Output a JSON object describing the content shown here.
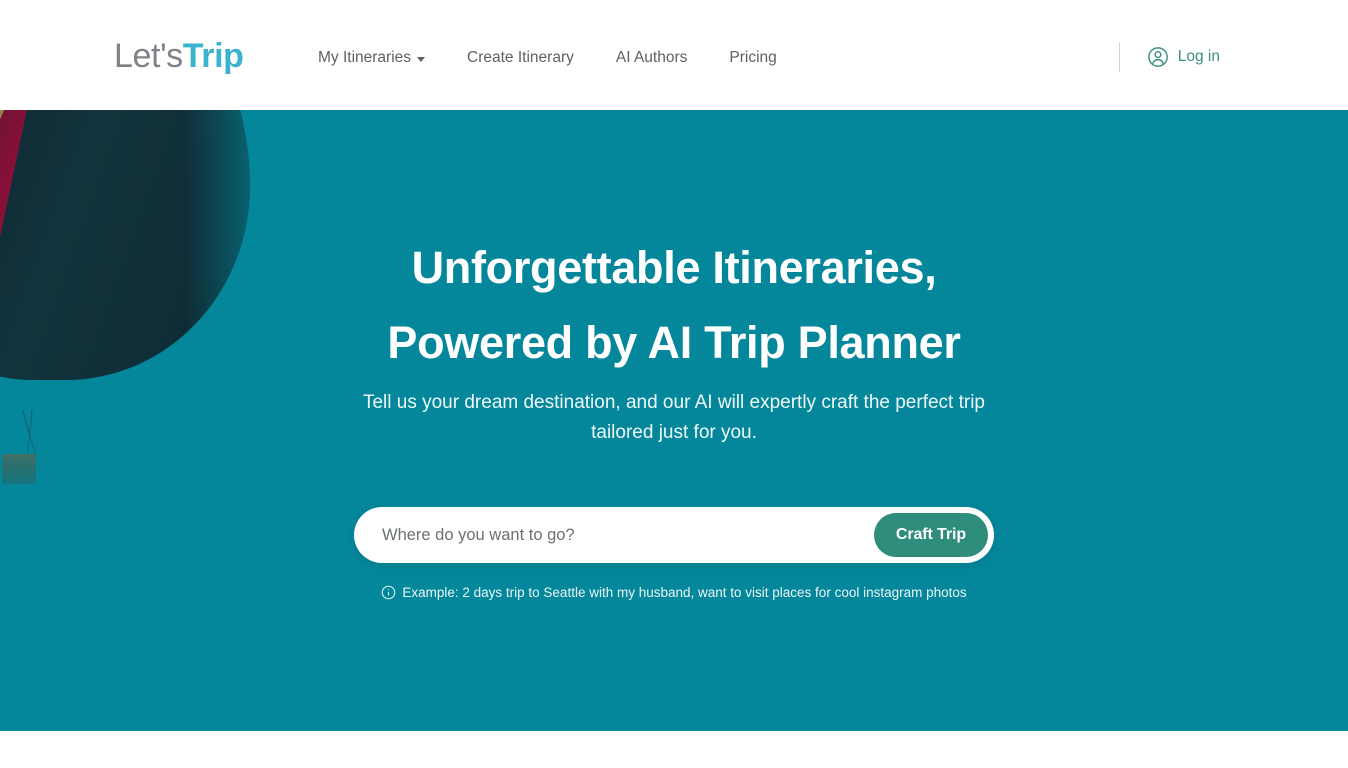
{
  "header": {
    "brand": {
      "part1": "Let's",
      "part2": "Trip"
    },
    "nav": [
      {
        "label": "My Itineraries",
        "has_dropdown": true,
        "icon": "chevron-down-icon"
      },
      {
        "label": "Create Itinerary",
        "has_dropdown": false
      },
      {
        "label": "AI Authors",
        "has_dropdown": false
      },
      {
        "label": "Pricing",
        "has_dropdown": false
      }
    ],
    "login": {
      "label": "Log in",
      "icon": "user-circle-icon"
    }
  },
  "hero": {
    "title_line1": "Unforgettable Itineraries,",
    "title_line2": "Powered by AI Trip Planner",
    "subtitle": "Tell us your dream destination, and our AI will expertly craft the perfect trip tailored just for you.",
    "search": {
      "placeholder": "Where do you want to go?",
      "value": "",
      "button_label": "Craft Trip"
    },
    "example_hint": "Example: 2 days trip to Seattle with my husband, want to visit places for cool instagram photos",
    "example_icon": "info-circle-icon",
    "background_image": "hot-air-balloon-photo"
  },
  "colors": {
    "hero_background": "#05879b",
    "brand_accent": "#3bb3cc",
    "brand_gray": "#7f8286",
    "craft_button": "#2f8d7c",
    "login_accent": "#3f8f7f",
    "nav_text": "#5d6165"
  }
}
